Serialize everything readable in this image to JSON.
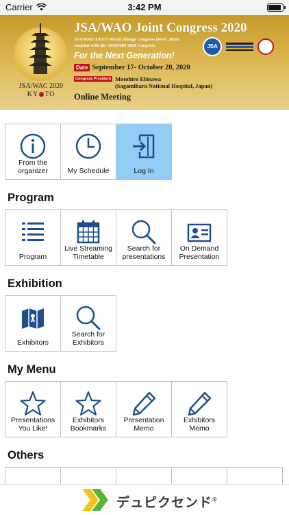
{
  "status_bar": {
    "carrier": "Carrier",
    "time": "3:42 PM"
  },
  "banner": {
    "title": "JSA/WAO Joint Congress 2020",
    "subtitle_line1": "JSA/WAO XXVII World Allergy Congress (WAC 2020)",
    "subtitle_line2": "conjoint with the APAPARI 2020 Congress",
    "slogan": "For the Next Generation!",
    "date_tag": "Date",
    "date_text": "September 17- October 20, 2020",
    "president_tag": "Congress President",
    "president_name": "Motohiro Ebisawa",
    "president_affiliation": "(Sagamihara National Hospital, Japan)",
    "format": "Online Meeting",
    "emblem_year": "JSA/WAC 2020",
    "emblem_city_a": "KY",
    "emblem_city_b": "TO",
    "logo_jsa": "JSA",
    "colors": {
      "gold": "#d9b24a",
      "red": "#c0121a"
    }
  },
  "top_tiles": [
    {
      "label": "From the organizer",
      "icon": "info-icon"
    },
    {
      "label": "My Schedule",
      "icon": "clock-icon"
    },
    {
      "label": "Log In",
      "icon": "login-icon",
      "active": true
    }
  ],
  "sections": {
    "program": {
      "title": "Program",
      "tiles": [
        {
          "label": "Program",
          "icon": "list-icon"
        },
        {
          "label": "Live Streaming Timetable",
          "icon": "calendar-icon"
        },
        {
          "label": "Search for presentations",
          "icon": "search-icon"
        },
        {
          "label": "On Demand Presentation",
          "icon": "id-card-icon"
        }
      ]
    },
    "exhibition": {
      "title": "Exhibition",
      "tiles": [
        {
          "label": "Exhibitors",
          "icon": "map-icon"
        },
        {
          "label": "Search for Exhibitors",
          "icon": "search-icon"
        }
      ]
    },
    "my_menu": {
      "title": "My Menu",
      "tiles": [
        {
          "label": "Presentations You Like!",
          "icon": "star-icon"
        },
        {
          "label": "Exhibitors Bookmarks",
          "icon": "star-icon"
        },
        {
          "label": "Presentation Memo",
          "icon": "pencil-icon"
        },
        {
          "label": "Exhibitors Memo",
          "icon": "pencil-icon"
        }
      ]
    },
    "others": {
      "title": "Others"
    }
  },
  "ad": {
    "brand": "デュピクセンド",
    "trademark": "®"
  },
  "colors": {
    "icon": "#1f4e8c",
    "active_tile": "#92cdf5",
    "tile_border": "#bfbfbf"
  }
}
